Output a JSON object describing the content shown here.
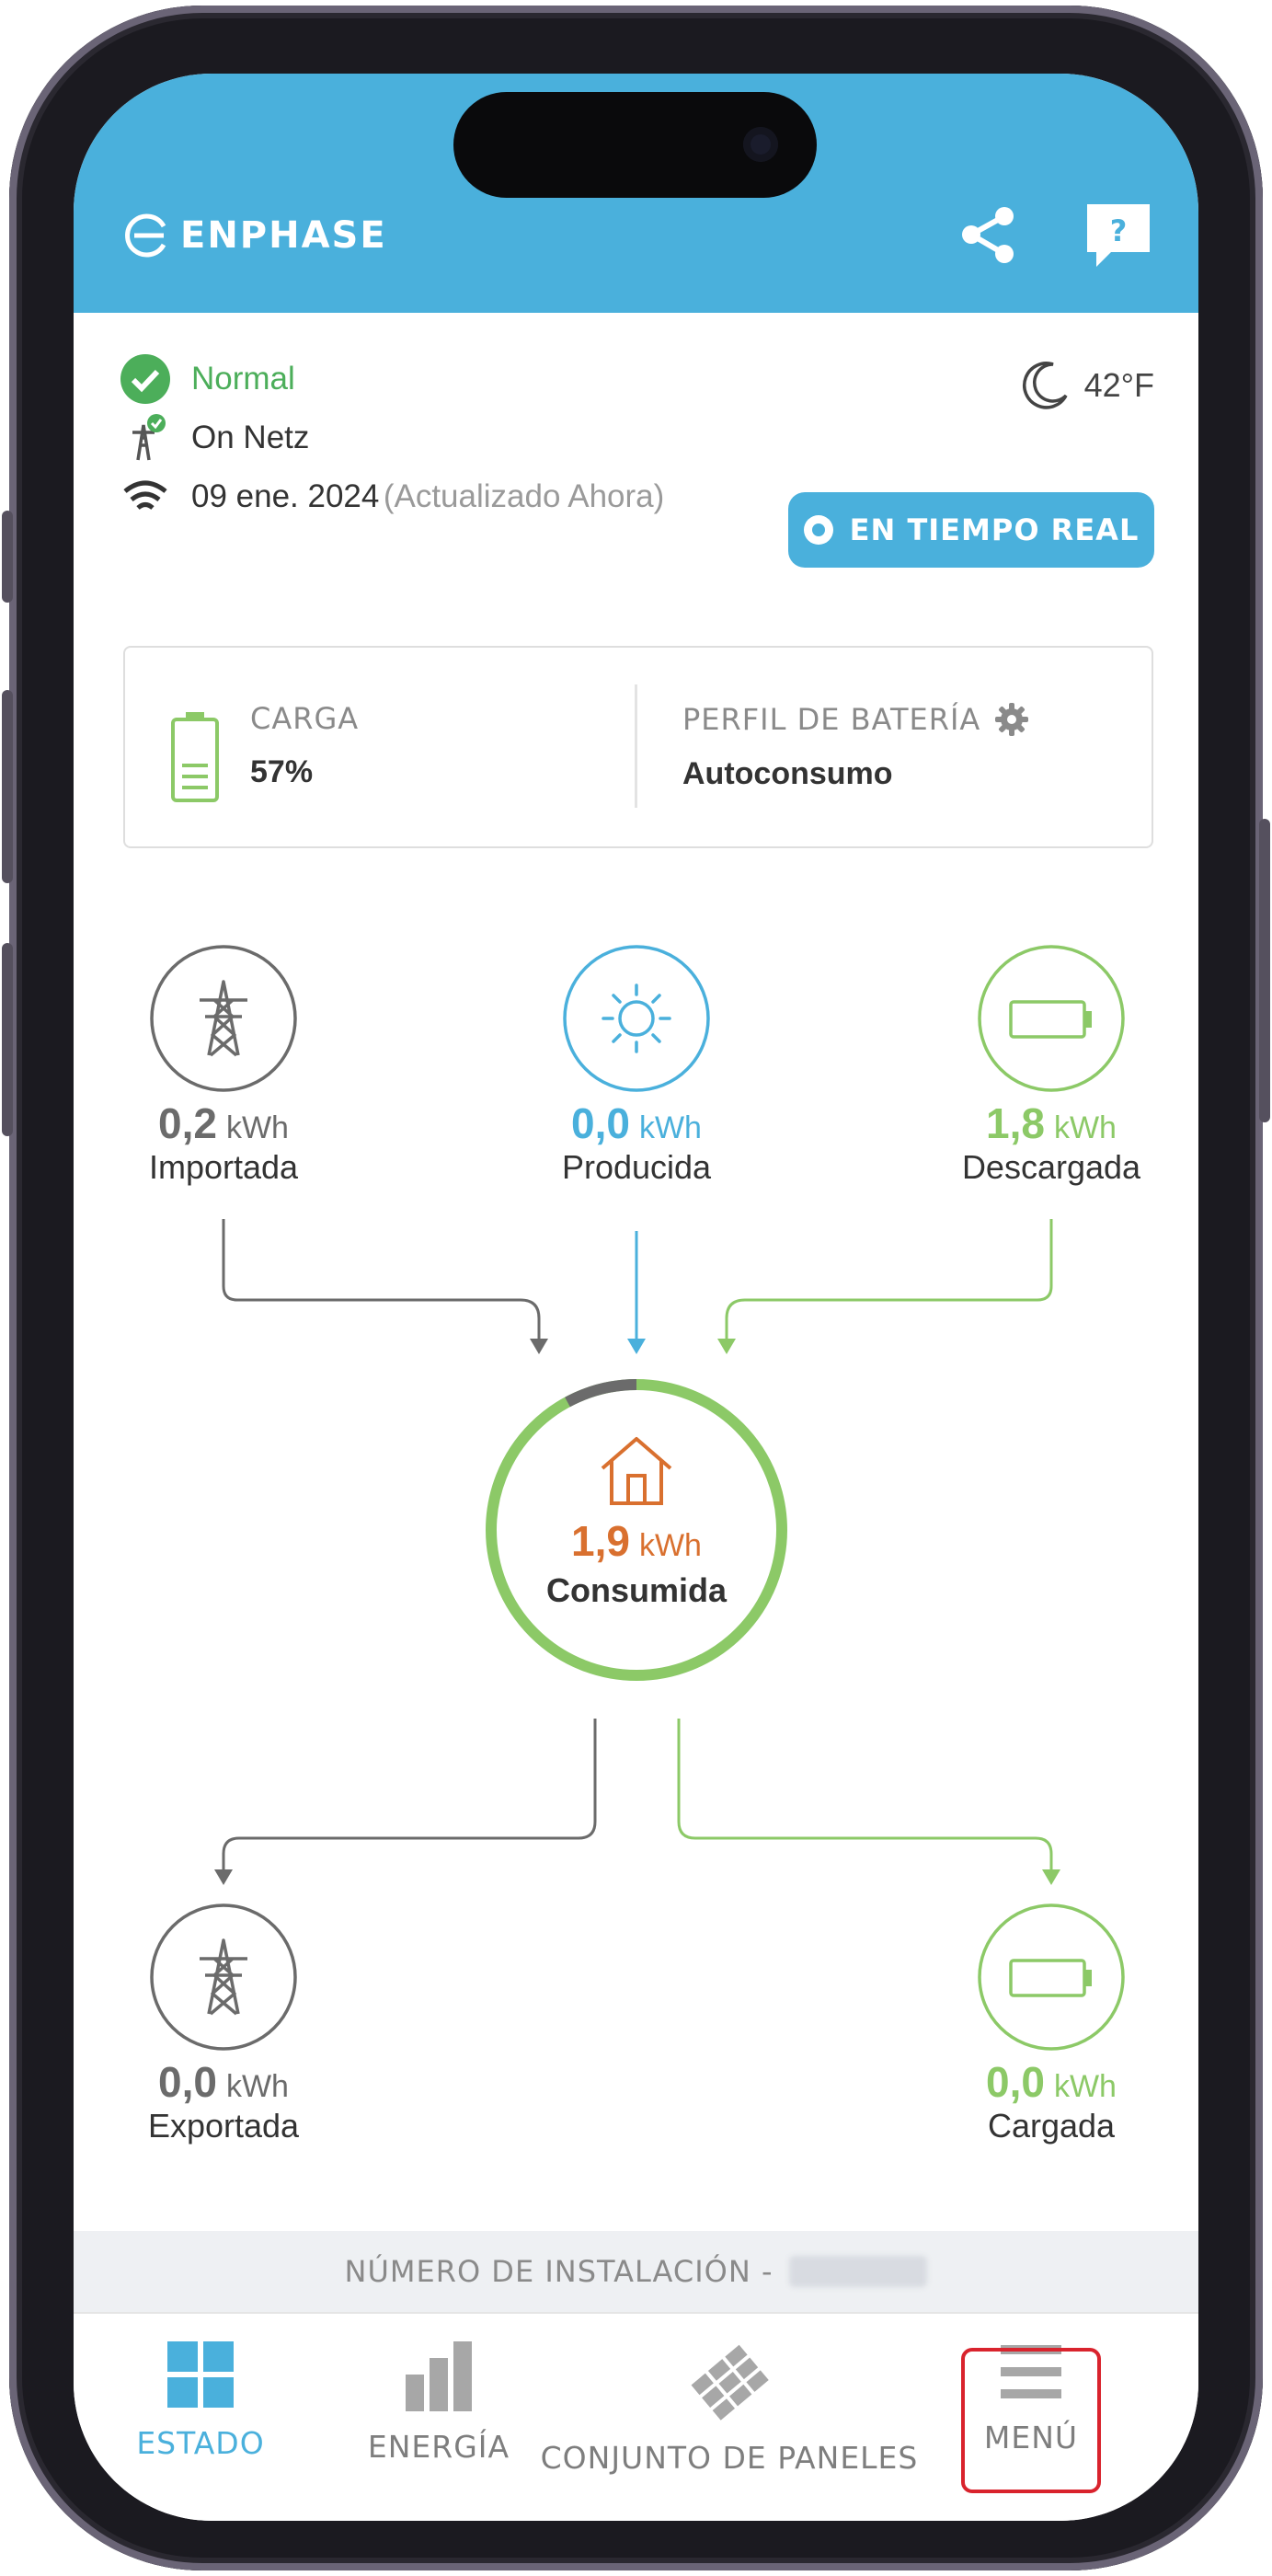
{
  "app": {
    "brand": "ENPHASE"
  },
  "colors": {
    "header": "#4ab0dc",
    "green": "#8cc967",
    "grey": "#6b6b6b",
    "blue": "#4ab0dc",
    "orange": "#d9702f"
  },
  "status": {
    "system": "Normal",
    "grid": "On Netz",
    "date": "09 ene. 2024",
    "updated": "(Actualizado Ahora)",
    "temperature": "42°F",
    "live_button": "EN TIEMPO REAL"
  },
  "battery_card": {
    "charge_label": "CARGA",
    "charge_value": "57%",
    "charge_level": 0.57,
    "profile_label": "PERFIL DE BATERÍA",
    "profile_value": "Autoconsumo"
  },
  "flow": {
    "imported": {
      "value": "0,2",
      "unit": "kWh",
      "label": "Importada"
    },
    "produced": {
      "value": "0,0",
      "unit": "kWh",
      "label": "Producida"
    },
    "discharged": {
      "value": "1,8",
      "unit": "kWh",
      "label": "Descargada"
    },
    "consumed": {
      "value": "1,9",
      "unit": "kWh",
      "label": "Consumida"
    },
    "exported": {
      "value": "0,0",
      "unit": "kWh",
      "label": "Exportada"
    },
    "charged": {
      "value": "0,0",
      "unit": "kWh",
      "label": "Cargada"
    }
  },
  "footer": {
    "installation_label": "NÚMERO DE INSTALACIÓN -"
  },
  "tabs": [
    {
      "label": "ESTADO",
      "icon": "grid-icon",
      "active": true
    },
    {
      "label": "ENERGÍA",
      "icon": "bar-chart-icon",
      "active": false
    },
    {
      "label": "CONJUNTO DE PANELES",
      "icon": "panels-icon",
      "active": false
    },
    {
      "label": "MENÚ",
      "icon": "hamburger-icon",
      "active": false
    }
  ]
}
